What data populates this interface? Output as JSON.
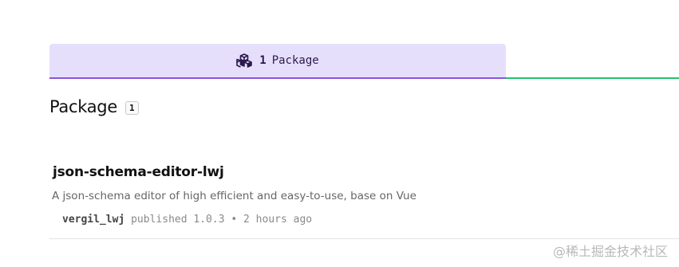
{
  "tabs": [
    {
      "count": "1",
      "label": "Package",
      "icon": "package-cubes-icon",
      "active": true
    }
  ],
  "colors": {
    "tab_active_bg": "#e6dffb",
    "tab_active_underline": "#8956d8",
    "tab_rest_underline": "#22c36a"
  },
  "section": {
    "title": "Package",
    "count": "1"
  },
  "packages": [
    {
      "name": "json-schema-editor-lwj",
      "description": "A json-schema editor of high efficient and easy-to-use, base on Vue",
      "author": "vergil_lwj",
      "published_text": "published",
      "version": "1.0.3",
      "separator": "•",
      "time": "2 hours ago"
    }
  ],
  "watermark": "@稀土掘金技术社区"
}
